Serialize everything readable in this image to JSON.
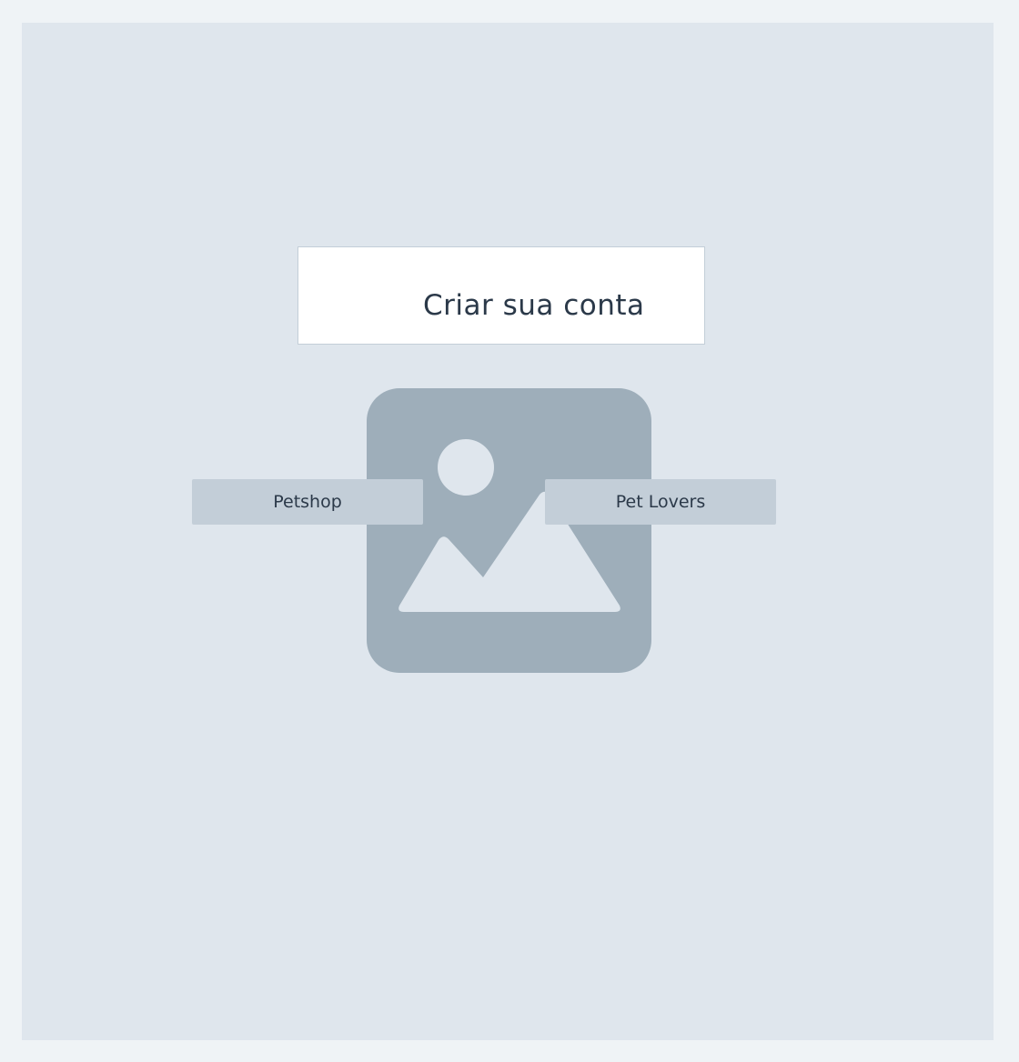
{
  "page": {
    "title": "Criar sua conta"
  },
  "placeholder_image": {
    "icon": "image-placeholder-icon"
  },
  "options": {
    "petshop_label": "Petshop",
    "pet_lovers_label": "Pet Lovers"
  },
  "colors": {
    "page_background": "#eff3f6",
    "canvas_background": "#dfe6ed",
    "button_background": "#c3ced8",
    "placeholder_fill": "#9eaeba",
    "text": "#2b3949"
  }
}
